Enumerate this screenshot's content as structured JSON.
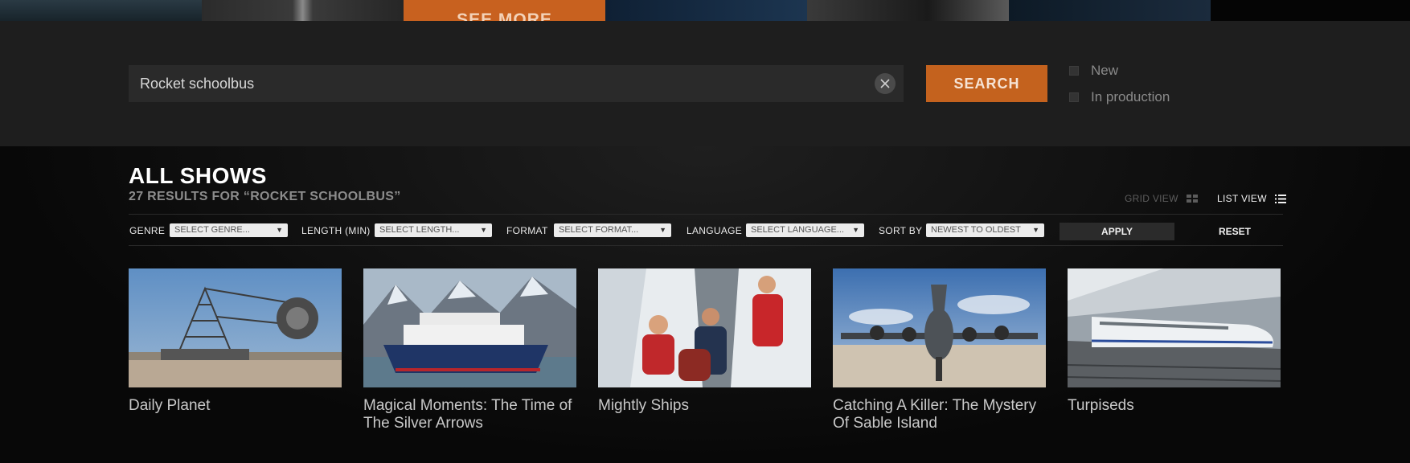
{
  "hero": {
    "see_more_label": "SEE MORE"
  },
  "search": {
    "value": "Rocket schoolbus",
    "button_label": "SEARCH",
    "filters": [
      {
        "label": "New",
        "checked": false
      },
      {
        "label": "In production",
        "checked": false
      }
    ]
  },
  "header": {
    "title": "ALL SHOWS",
    "results_text": "27 RESULTS FOR “ROCKET SCHOOLBUS”",
    "grid_view_label": "GRID VIEW",
    "list_view_label": "LIST VIEW",
    "active_view": "list"
  },
  "filter_bar": {
    "genre": {
      "label": "GENRE",
      "selected": "SELECT GENRE..."
    },
    "length": {
      "label": "LENGTH (MIN)",
      "selected": "SELECT LENGTH..."
    },
    "format": {
      "label": "FORMAT",
      "selected": "SELECT FORMAT..."
    },
    "language": {
      "label": "LANGUAGE",
      "selected": "SELECT LANGUAGE..."
    },
    "sort": {
      "label": "SORT BY",
      "selected": "NEWEST TO OLDEST"
    },
    "apply_label": "APPLY",
    "reset_label": "RESET"
  },
  "shows": [
    {
      "title": "Daily Planet"
    },
    {
      "title": "Magical Moments: The Time of The Silver Arrows"
    },
    {
      "title": "Mightly Ships"
    },
    {
      "title": "Catching A Killer: The Mystery Of Sable Island"
    },
    {
      "title": "Turpiseds"
    }
  ],
  "colors": {
    "accent": "#c4621e",
    "band": "#1e1e1e",
    "background": "#0b0b0b"
  }
}
